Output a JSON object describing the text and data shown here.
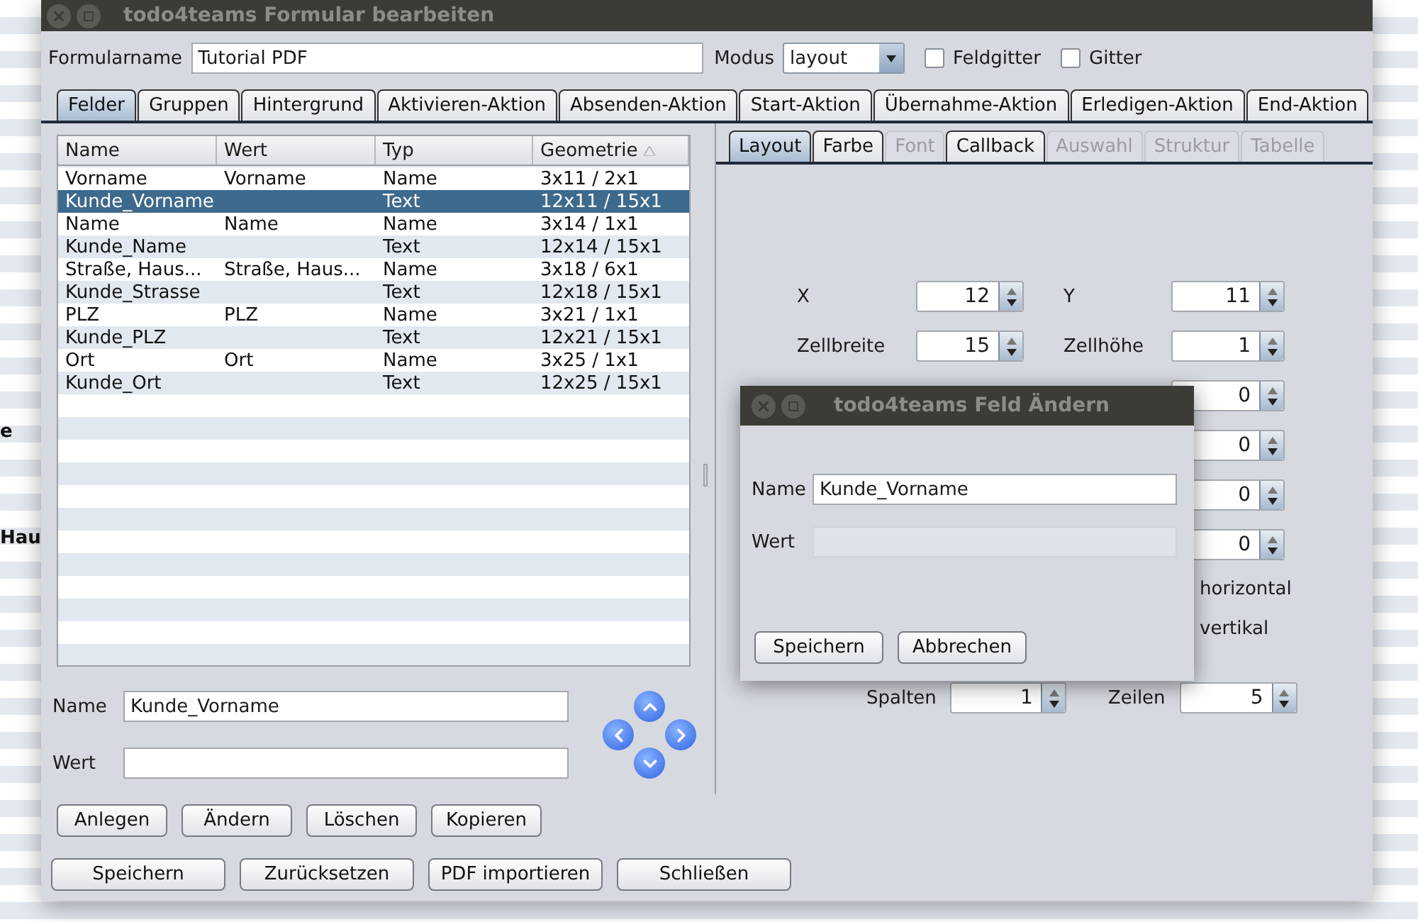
{
  "desktop": {
    "texts": [
      "e",
      "Hau"
    ]
  },
  "window": {
    "title": "todo4teams Formular bearbeiten"
  },
  "form": {
    "name_label": "Formularname",
    "name_value": "Tutorial PDF",
    "mode_label": "Modus",
    "mode_value": "layout",
    "checkboxes": [
      {
        "label": "Feldgitter",
        "checked": false
      },
      {
        "label": "Gitter",
        "checked": false
      }
    ]
  },
  "tabs": [
    {
      "label": "Felder",
      "selected": true
    },
    {
      "label": "Gruppen",
      "selected": false
    },
    {
      "label": "Hintergrund",
      "selected": false
    },
    {
      "label": "Aktivieren-Aktion",
      "selected": false
    },
    {
      "label": "Absenden-Aktion",
      "selected": false
    },
    {
      "label": "Start-Aktion",
      "selected": false
    },
    {
      "label": "Übernahme-Aktion",
      "selected": false
    },
    {
      "label": "Erledigen-Aktion",
      "selected": false
    },
    {
      "label": "End-Aktion",
      "selected": false
    }
  ],
  "table": {
    "columns": [
      {
        "label": "Name",
        "sorted": false
      },
      {
        "label": "Wert",
        "sorted": false
      },
      {
        "label": "Typ",
        "sorted": false
      },
      {
        "label": "Geometrie",
        "sorted": true
      }
    ],
    "rows": [
      {
        "cells": [
          "Vorname",
          "Vorname",
          "Name",
          "3x11 / 2x1"
        ],
        "selected": false
      },
      {
        "cells": [
          "Kunde_Vorname",
          "",
          "Text",
          "12x11 / 15x1"
        ],
        "selected": true
      },
      {
        "cells": [
          "Name",
          "Name",
          "Name",
          "3x14 / 1x1"
        ],
        "selected": false
      },
      {
        "cells": [
          "Kunde_Name",
          "",
          "Text",
          "12x14 / 15x1"
        ],
        "selected": false
      },
      {
        "cells": [
          "Straße, Haus...",
          "Straße, Haus...",
          "Name",
          "3x18 / 6x1"
        ],
        "selected": false
      },
      {
        "cells": [
          "Kunde_Strasse",
          "",
          "Text",
          "12x18 / 15x1"
        ],
        "selected": false
      },
      {
        "cells": [
          "PLZ",
          "PLZ",
          "Name",
          "3x21 / 1x1"
        ],
        "selected": false
      },
      {
        "cells": [
          "Kunde_PLZ",
          "",
          "Text",
          "12x21 / 15x1"
        ],
        "selected": false
      },
      {
        "cells": [
          "Ort",
          "Ort",
          "Name",
          "3x25 / 1x1"
        ],
        "selected": false
      },
      {
        "cells": [
          "Kunde_Ort",
          "",
          "Text",
          "12x25 / 15x1"
        ],
        "selected": false
      }
    ]
  },
  "editor": {
    "fields": [
      {
        "label": "Name",
        "value": "Kunde_Vorname"
      },
      {
        "label": "Wert"
      }
    ]
  },
  "actions": [
    "Anlegen",
    "Ändern",
    "Löschen",
    "Kopieren"
  ],
  "sub_tabs": [
    {
      "label": "Layout",
      "selected": true,
      "disabled": false
    },
    {
      "label": "Farbe",
      "selected": false,
      "disabled": false
    },
    {
      "label": "Font",
      "selected": false,
      "disabled": true
    },
    {
      "label": "Callback",
      "selected": false,
      "disabled": false
    },
    {
      "label": "Auswahl",
      "selected": false,
      "disabled": true
    },
    {
      "label": "Struktur",
      "selected": false,
      "disabled": true
    },
    {
      "label": "Tabelle",
      "selected": false,
      "disabled": true
    }
  ],
  "layout_rows": [
    {
      "left": {
        "label": "X",
        "value": "12"
      },
      "right": {
        "label": "Y",
        "value": "11"
      }
    },
    {
      "left": {
        "label": "Zellbreite",
        "value": "15"
      },
      "right": {
        "label": "Zellhöhe",
        "value": "1"
      }
    },
    {
      "right": {
        "value": "0"
      }
    },
    {
      "right": {
        "value": "0"
      }
    },
    {
      "right": {
        "value": "0"
      }
    },
    {
      "right": {
        "value": "0"
      }
    }
  ],
  "alignment_labels": [
    "horizontal",
    "vertikal"
  ],
  "grid": [
    {
      "label": "Spalten",
      "value": "1"
    },
    {
      "label": "Zeilen",
      "value": "5"
    }
  ],
  "footer_buttons": [
    "Speichern",
    "Zurücksetzen",
    "PDF importieren",
    "Schließen"
  ],
  "dialog": {
    "title": "todo4teams Feld Ändern",
    "fields": [
      {
        "label": "Name",
        "value": "Kunde_Vorname",
        "disabled": false
      },
      {
        "label": "Wert",
        "disabled": true
      }
    ],
    "buttons": [
      "Speichern",
      "Abbrechen"
    ]
  }
}
